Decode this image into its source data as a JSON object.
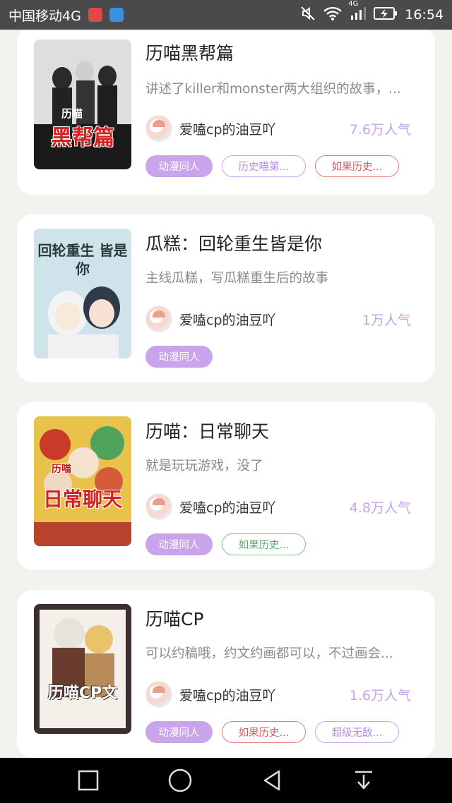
{
  "status_bar": {
    "carrier": "中国移动4G",
    "network": "4G",
    "time": "16:54"
  },
  "cards": [
    {
      "title": "历喵黑帮篇",
      "description": "讲述了killer和monster两大组织的故事，...",
      "author": "爱嗑cp的油豆吖",
      "popularity": "7.6万人气",
      "cover_text": "黑帮篇",
      "cover_label": "历喵",
      "tags": [
        {
          "label": "动漫同人",
          "style": "filled"
        },
        {
          "label": "历史喵第...",
          "style": "purple"
        },
        {
          "label": "如果历史...",
          "style": "red"
        }
      ]
    },
    {
      "title": "瓜糕：回轮重生皆是你",
      "description": "主线瓜糕，写瓜糕重生后的故事",
      "author": "爱嗑cp的油豆吖",
      "popularity": "1万人气",
      "cover_text": "回轮重生 皆是你",
      "cover_label": "",
      "tags": [
        {
          "label": "动漫同人",
          "style": "filled"
        }
      ]
    },
    {
      "title": "历喵：日常聊天",
      "description": "就是玩玩游戏，没了",
      "author": "爱嗑cp的油豆吖",
      "popularity": "4.8万人气",
      "cover_text": "日常聊天",
      "cover_label": "历喵",
      "tags": [
        {
          "label": "动漫同人",
          "style": "filled"
        },
        {
          "label": "如果历史...",
          "style": "green"
        }
      ]
    },
    {
      "title": "历喵CP",
      "description": "可以约稿哦，约文约画都可以，不过画会...",
      "author": "爱嗑cp的油豆吖",
      "popularity": "1.6万人气",
      "cover_text": "历喵CP文",
      "cover_label": "",
      "tags": [
        {
          "label": "动漫同人",
          "style": "filled"
        },
        {
          "label": "如果历史...",
          "style": "red"
        },
        {
          "label": "超级无敌...",
          "style": "purple"
        }
      ]
    }
  ],
  "colors": {
    "accent": "#c9a4ea",
    "popularity": "#c6a2e8",
    "background": "#f2f2ef"
  },
  "nav": [
    "recent-apps-icon",
    "home-icon",
    "back-icon",
    "notification-pull-icon"
  ]
}
